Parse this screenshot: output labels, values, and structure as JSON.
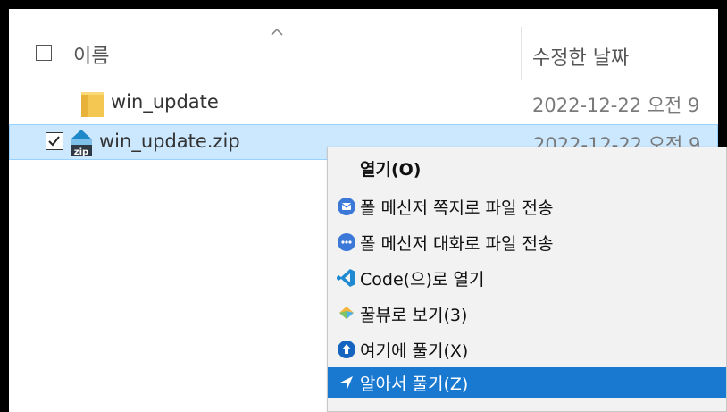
{
  "header": {
    "name_label": "이름",
    "date_label": "수정한 날짜"
  },
  "files": [
    {
      "name": "win_update",
      "date": "2022-12-22 오전 9"
    },
    {
      "name": "win_update.zip",
      "date": "2022-12-22 오전 9"
    }
  ],
  "context_menu": {
    "items": [
      {
        "label": "열기(O)",
        "icon": ""
      },
      {
        "label": "폴 메신저 쪽지로 파일 전송",
        "icon": "messenger-note-icon"
      },
      {
        "label": "폴 메신저 대화로 파일 전송",
        "icon": "messenger-chat-icon"
      },
      {
        "label": "Code(으)로 열기",
        "icon": "vscode-icon"
      },
      {
        "label": "꿀뷰로 보기(3)",
        "icon": "honeyview-icon"
      },
      {
        "label": "여기에 풀기(X)",
        "icon": "extract-here-icon"
      },
      {
        "label": "알아서 풀기(Z)",
        "icon": "smart-extract-icon"
      }
    ]
  },
  "colors": {
    "selection_bg": "#cce8ff",
    "menu_highlight": "#1979d1"
  }
}
